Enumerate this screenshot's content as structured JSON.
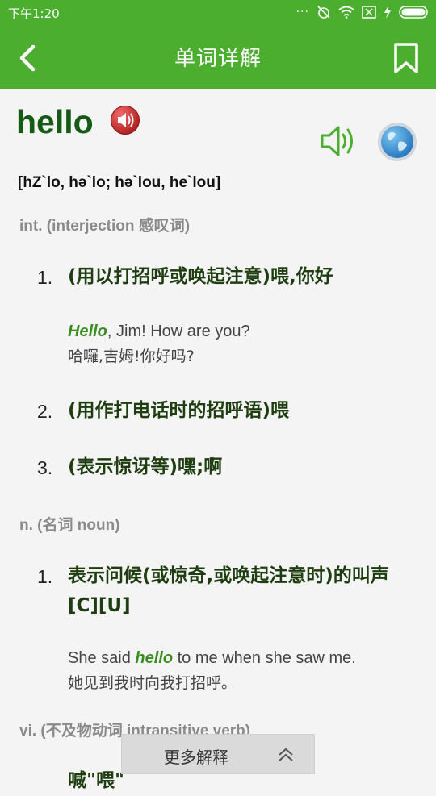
{
  "status_bar": {
    "time": "下午1:20"
  },
  "app_bar": {
    "title": "单词详解"
  },
  "entry": {
    "word": "hello",
    "phonetic": "[hZ`lo, hə`lo; hə`lou, he`lou]"
  },
  "sections": [
    {
      "pos": "int. (interjection 感叹词)",
      "senses": [
        {
          "num": "1.",
          "def": "(用以打招呼或唤起注意)喂,你好",
          "example_hl": "Hello",
          "example_after": ", Jim! How are you?",
          "translation": "哈囉,吉姆!你好吗?"
        },
        {
          "num": "2.",
          "def": "(用作打电话时的招呼语)喂"
        },
        {
          "num": "3.",
          "def": "(表示惊讶等)嘿;啊"
        }
      ]
    },
    {
      "pos": "n. (名词 noun)",
      "senses": [
        {
          "num": "1.",
          "def": "表示问候(或惊奇,或唤起注意时)的叫声[C][U]",
          "example_before": "She said ",
          "example_hl": "hello",
          "example_after": " to me when she saw me.",
          "translation": "她见到我时向我打招呼。"
        }
      ]
    },
    {
      "pos": "vi. (不及物动词 intransitive verb)",
      "senses": [
        {
          "def_partial": "喊\"喂\""
        }
      ]
    }
  ],
  "more_button": {
    "label": "更多解释"
  },
  "icons": {
    "back": "back-arrow-icon",
    "bookmark": "bookmark-icon",
    "audio_red": "red-speaker-icon",
    "audio_green": "green-speaker-icon",
    "globe": "globe-icon",
    "chevron": "double-chevron-up-icon"
  },
  "colors": {
    "accent": "#4cae2f",
    "word": "#155a15",
    "highlight": "#3a8d21"
  }
}
